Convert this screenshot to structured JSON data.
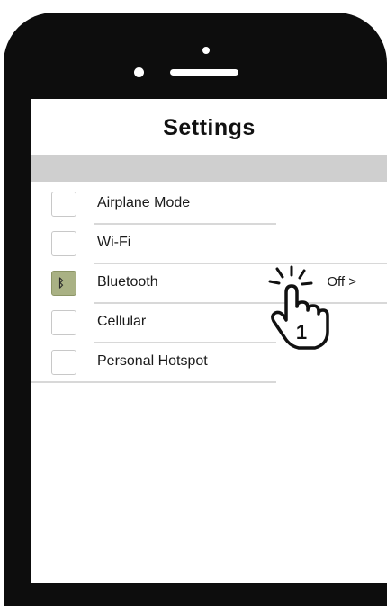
{
  "header": {
    "title": "Settings"
  },
  "settings": {
    "items": [
      {
        "label": "Airplane Mode",
        "active": false
      },
      {
        "label": "Wi-Fi",
        "active": false
      },
      {
        "label": "Bluetooth",
        "active": true,
        "status": "Off >"
      },
      {
        "label": "Cellular",
        "active": false
      },
      {
        "label": "Personal Hotspot",
        "active": false
      }
    ]
  },
  "tap_hint": {
    "step_number": "1"
  },
  "colors": {
    "bluetooth_icon_bg": "#a9b184",
    "phone_frame": "#0d0d0d",
    "section_band": "#cfcfcf"
  }
}
